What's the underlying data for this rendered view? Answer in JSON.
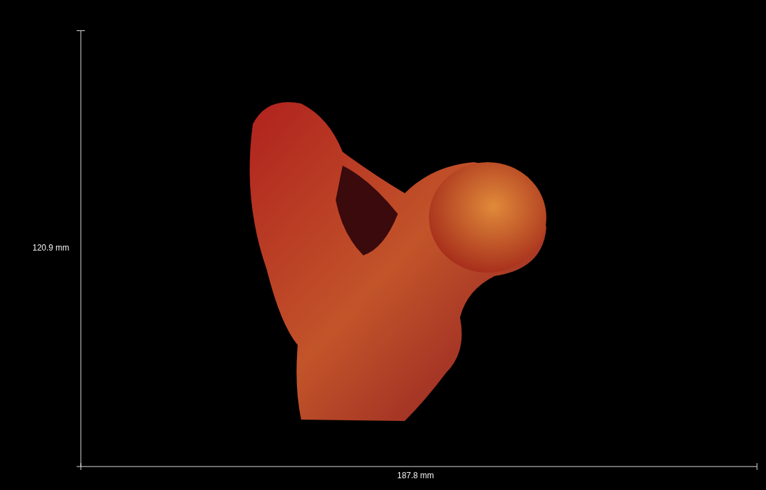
{
  "viewport": {
    "vertical_measure": "120.9 mm",
    "horizontal_measure": "187.8 mm"
  }
}
